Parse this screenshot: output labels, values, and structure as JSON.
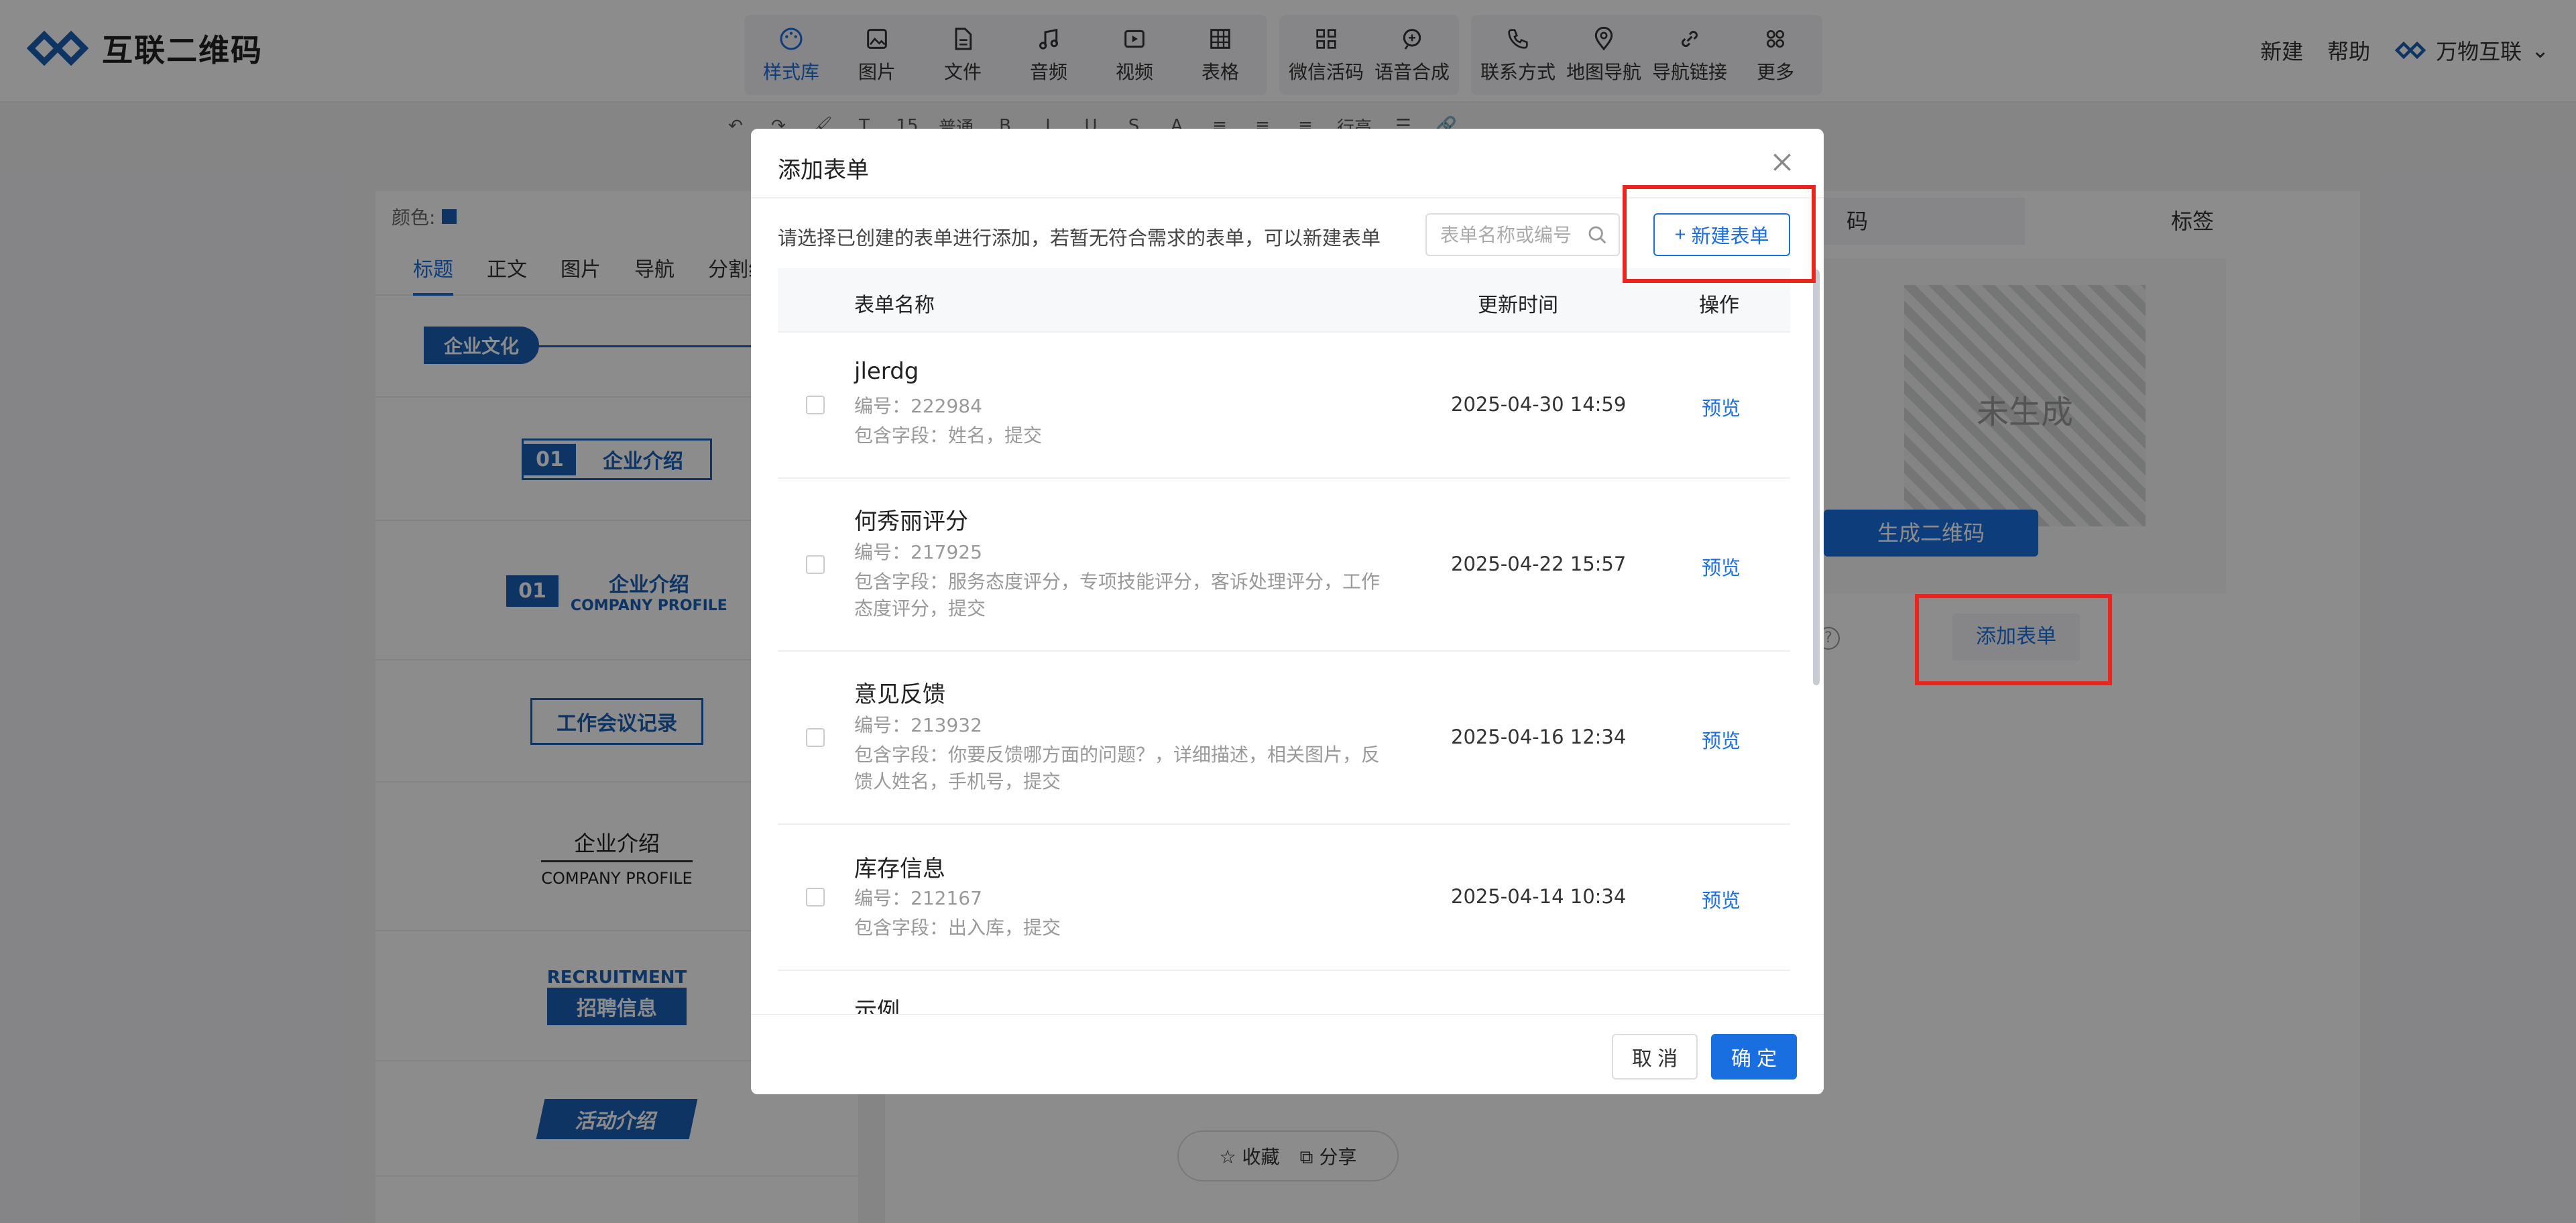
{
  "brand": {
    "name": "互联二维码"
  },
  "tools": [
    {
      "label": "样式库",
      "icon": "palette-icon",
      "active": true
    },
    {
      "label": "图片",
      "icon": "image-icon"
    },
    {
      "label": "文件",
      "icon": "file-icon"
    },
    {
      "label": "音频",
      "icon": "music-icon"
    },
    {
      "label": "视频",
      "icon": "video-icon"
    },
    {
      "label": "表格",
      "icon": "table-icon"
    },
    {
      "label": "微信活码",
      "icon": "wechat-code-icon"
    },
    {
      "label": "语音合成",
      "icon": "voice-icon"
    },
    {
      "label": "联系方式",
      "icon": "phone-icon"
    },
    {
      "label": "地图导航",
      "icon": "map-pin-icon"
    },
    {
      "label": "导航链接",
      "icon": "link-icon"
    },
    {
      "label": "更多",
      "icon": "more-grid-icon"
    }
  ],
  "top_right": {
    "new": "新建",
    "help": "帮助",
    "account": "万物互联"
  },
  "format_toolbar": {
    "font_size": "15",
    "style": "普通",
    "line_height": "行高"
  },
  "left_panel": {
    "color_label": "颜色:",
    "tabs": [
      "标题",
      "正文",
      "图片",
      "导航",
      "分割线"
    ],
    "samples": {
      "s1": "企业文化",
      "s2_num": "01",
      "s2_text": "企业介绍",
      "s3_num": "01",
      "s3_text": "企业介绍",
      "s3_sub": "COMPANY PROFILE",
      "s4": "工作会议记录",
      "s5_text": "企业介绍",
      "s5_sub": "COMPANY PROFILE",
      "s6_top": "RECRUITMENT",
      "s6_main": "招聘信息",
      "s7": "活动介绍"
    }
  },
  "share_bar": {
    "favorite": "收藏",
    "share": "分享"
  },
  "right_panel": {
    "tabs": [
      "码",
      "标签"
    ],
    "qr_placeholder": "未生成",
    "generate_button": "生成二维码",
    "add_form_button": "添加表单",
    "help_mark": "?"
  },
  "modal": {
    "title": "添加表单",
    "tip": "请选择已创建的表单进行添加，若暂无符合需求的表单，可以新建表单",
    "search_placeholder": "表单名称或编号",
    "new_form_button": "新建表单",
    "columns": {
      "name": "表单名称",
      "updated": "更新时间",
      "action": "操作"
    },
    "rows": [
      {
        "name": "jlerdg",
        "id": "编号：222984",
        "fields": "包含字段：姓名，提交",
        "updated": "2025-04-30 14:59",
        "action": "预览"
      },
      {
        "name": "何秀丽评分",
        "id": "编号：217925",
        "fields": "包含字段：服务态度评分，专项技能评分，客诉处理评分，工作态度评分，提交",
        "updated": "2025-04-22 15:57",
        "action": "预览"
      },
      {
        "name": "意见反馈",
        "id": "编号：213932",
        "fields": "包含字段：你要反馈哪方面的问题？，详细描述，相关图片，反馈人姓名，手机号，提交",
        "updated": "2025-04-16 12:34",
        "action": "预览"
      },
      {
        "name": "库存信息",
        "id": "编号：212167",
        "fields": "包含字段：出入库，提交",
        "updated": "2025-04-14 10:34",
        "action": "预览"
      },
      {
        "name": "示例",
        "id": "",
        "fields": "",
        "updated": "",
        "action": ""
      }
    ],
    "cancel": "取 消",
    "confirm": "确 定"
  },
  "colors": {
    "accent": "#1a6fe0",
    "highlight": "#e8251f",
    "brand_blue": "#1a5fb4"
  }
}
